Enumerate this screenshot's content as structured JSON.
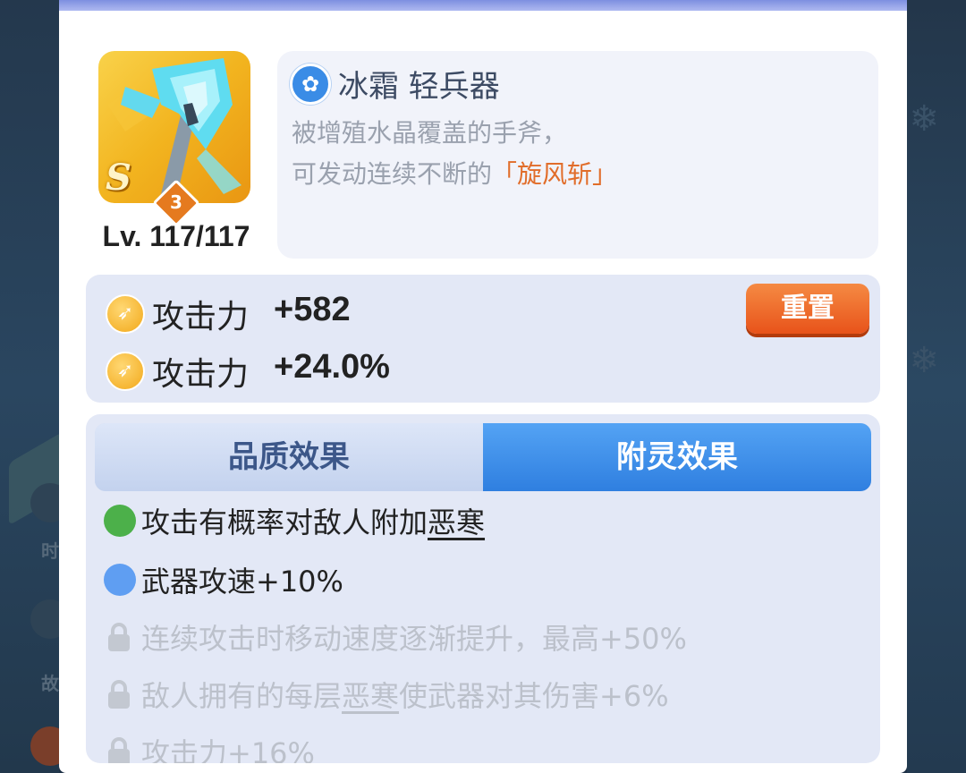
{
  "weapon": {
    "rank": "S",
    "stars": "3",
    "level": "Lv. 117/117",
    "element_icon": "snowflake-icon",
    "name": "冰霜 轻兵器",
    "desc_line1": "被增殖水晶覆盖的手斧，",
    "desc_line2_prefix": "可发动连续不断的",
    "desc_line2_highlight": "「旋风斩」"
  },
  "stats": {
    "rows": [
      {
        "icon": "attack-icon",
        "label": "攻击力",
        "value": "+582"
      },
      {
        "icon": "attack-icon",
        "label": "攻击力",
        "value": "+24.0%"
      }
    ],
    "reset_label": "重置"
  },
  "tabs": [
    {
      "label": "品质效果",
      "active": false
    },
    {
      "label": "附灵效果",
      "active": true
    }
  ],
  "effects": [
    {
      "bullet": "green-dot",
      "color": "#4cb04a",
      "prefix": "攻击有概率对敌人附加",
      "underline": "恶寒",
      "suffix": "",
      "locked": false
    },
    {
      "bullet": "blue-dot",
      "color": "#5f9ef2",
      "prefix": "武器攻速+10%",
      "underline": "",
      "suffix": "",
      "locked": false
    },
    {
      "bullet": "lock-icon",
      "prefix": "连续攻击时移动速度逐渐提升，最高+50%",
      "underline": "",
      "suffix": "",
      "locked": true
    },
    {
      "bullet": "lock-icon",
      "prefix": "敌人拥有的每层",
      "underline": "恶寒",
      "suffix": "使武器对其伤害+6%",
      "locked": true
    },
    {
      "bullet": "lock-icon",
      "prefix": "攻击力+16%",
      "underline": "",
      "suffix": "",
      "locked": true
    }
  ],
  "background": {
    "side_glyph_1": "时",
    "side_glyph_2": "故"
  },
  "colors": {
    "accent_blue": "#2f7fe0",
    "reset_orange": "#e8531a",
    "highlight_orange": "#e16d2a"
  }
}
